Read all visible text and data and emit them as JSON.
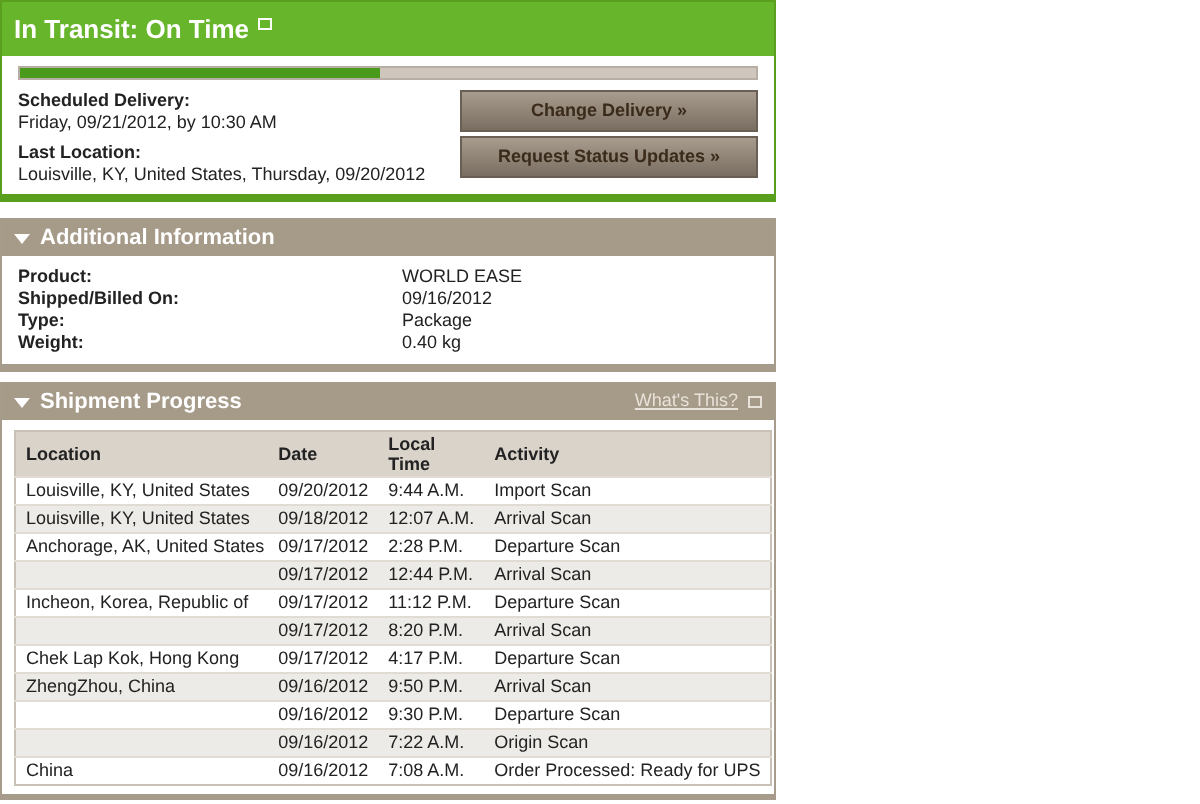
{
  "status": {
    "title": "In Transit: On Time",
    "level": 0.49
  },
  "delivery": [
    {
      "label": "Scheduled Delivery:",
      "value": "Friday, 09/21/2012, by 10:30 AM"
    },
    {
      "label": "Last Location:",
      "value": "Louisville, KY, United States, Thursday, 09/20/2012"
    }
  ],
  "buttons": [
    "Change Delivery »",
    "Request Status Updates »"
  ],
  "additional_information": {
    "title": "Additional Information",
    "expanded": true,
    "fields": [
      {
        "label": "Product:",
        "value": "WORLD EASE"
      },
      {
        "label": "Shipped/Billed On:",
        "value": "09/16/2012"
      },
      {
        "label": "Type:",
        "value": "Package"
      },
      {
        "label": "Weight:",
        "value": "0.40 kg"
      }
    ]
  },
  "shipment_progress": {
    "title": "Shipment Progress",
    "expanded": true,
    "help_link": "What's This?",
    "table": {
      "columns": [
        "Location",
        "Date",
        "Local Time",
        "Activity"
      ],
      "rows": [
        [
          "Louisville, KY, United States",
          "09/20/2012",
          "9:44 A.M.",
          "Import Scan"
        ],
        [
          "Louisville, KY, United States",
          "09/18/2012",
          "12:07 A.M.",
          "Arrival Scan"
        ],
        [
          "Anchorage, AK, United States",
          "09/17/2012",
          "2:28 P.M.",
          "Departure Scan"
        ],
        [
          "",
          "09/17/2012",
          "12:44 P.M.",
          "Arrival Scan"
        ],
        [
          "Incheon, Korea, Republic of",
          "09/17/2012",
          "11:12 P.M.",
          "Departure Scan"
        ],
        [
          "",
          "09/17/2012",
          "8:20 P.M.",
          "Arrival Scan"
        ],
        [
          "Chek Lap Kok, Hong Kong",
          "09/17/2012",
          "4:17 P.M.",
          "Departure Scan"
        ],
        [
          "ZhengZhou, China",
          "09/16/2012",
          "9:50 P.M.",
          "Arrival Scan"
        ],
        [
          "",
          "09/16/2012",
          "9:30 P.M.",
          "Departure Scan"
        ],
        [
          "",
          "09/16/2012",
          "7:22 A.M.",
          "Origin Scan"
        ],
        [
          "China",
          "09/16/2012",
          "7:08 A.M.",
          "Order Processed: Ready for UPS"
        ]
      ]
    }
  }
}
